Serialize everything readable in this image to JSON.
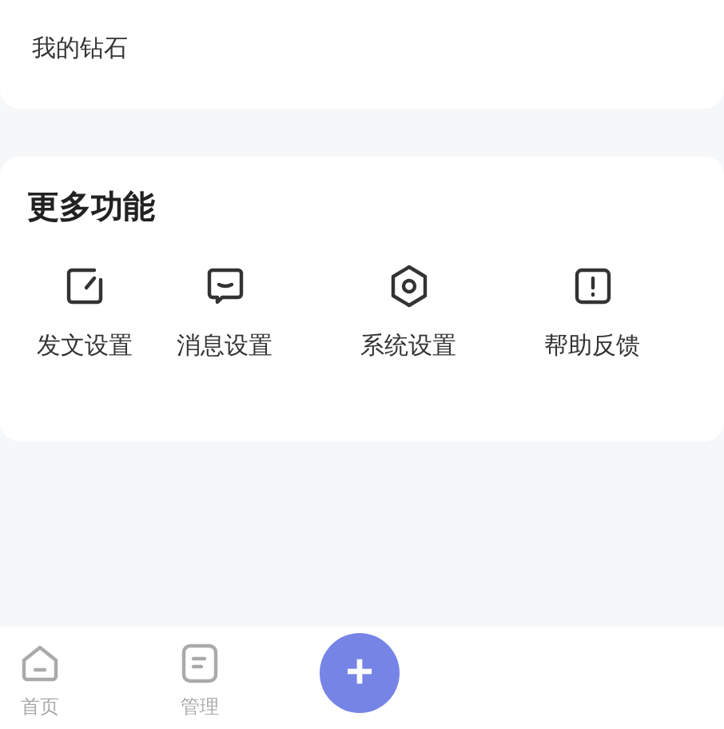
{
  "diamond_card": {
    "label": "我的钻石"
  },
  "more_features": {
    "title": "更多功能",
    "items": [
      {
        "kind": "edit",
        "label": "发文设置"
      },
      {
        "kind": "message",
        "label": "消息设置"
      },
      {
        "kind": "settings",
        "label": "系统设置"
      },
      {
        "kind": "help",
        "label": "帮助反馈"
      }
    ]
  },
  "tab_bar": {
    "tabs": [
      {
        "kind": "home",
        "label": "首页",
        "selected": false
      },
      {
        "kind": "manage",
        "label": "管理",
        "selected": false
      }
    ],
    "add_button": {
      "label": "+"
    }
  }
}
